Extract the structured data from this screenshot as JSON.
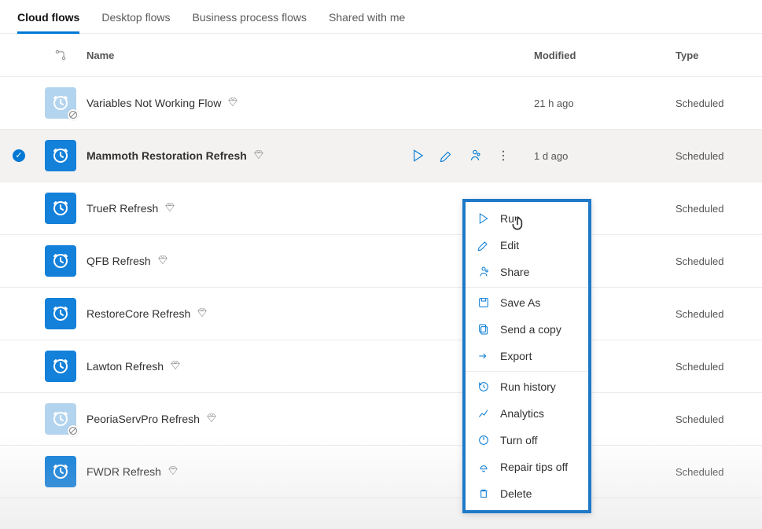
{
  "tabs": {
    "cloud": "Cloud flows",
    "desktop": "Desktop flows",
    "bpf": "Business process flows",
    "shared": "Shared with me"
  },
  "columns": {
    "name": "Name",
    "modified": "Modified",
    "type": "Type"
  },
  "rows": [
    {
      "name": "Variables Not Working Flow",
      "modified": "21 h ago",
      "type": "Scheduled",
      "disabled": true,
      "selected": false
    },
    {
      "name": "Mammoth Restoration Refresh",
      "modified": "1 d ago",
      "type": "Scheduled",
      "disabled": false,
      "selected": true
    },
    {
      "name": "TrueR Refresh",
      "modified": "",
      "type": "Scheduled",
      "disabled": false,
      "selected": false
    },
    {
      "name": "QFB Refresh",
      "modified": "",
      "type": "Scheduled",
      "disabled": false,
      "selected": false
    },
    {
      "name": "RestoreCore Refresh",
      "modified": "",
      "type": "Scheduled",
      "disabled": false,
      "selected": false
    },
    {
      "name": "Lawton Refresh",
      "modified": "",
      "type": "Scheduled",
      "disabled": false,
      "selected": false
    },
    {
      "name": "PeoriaServPro Refresh",
      "modified": "",
      "type": "Scheduled",
      "disabled": true,
      "selected": false
    },
    {
      "name": "FWDR Refresh",
      "modified": "",
      "type": "Scheduled",
      "disabled": false,
      "selected": false
    }
  ],
  "menu": {
    "run": "Run",
    "edit": "Edit",
    "share": "Share",
    "saveas": "Save As",
    "sendcopy": "Send a copy",
    "export": "Export",
    "runhistory": "Run history",
    "analytics": "Analytics",
    "turnoff": "Turn off",
    "repairtips": "Repair tips off",
    "delete": "Delete"
  }
}
